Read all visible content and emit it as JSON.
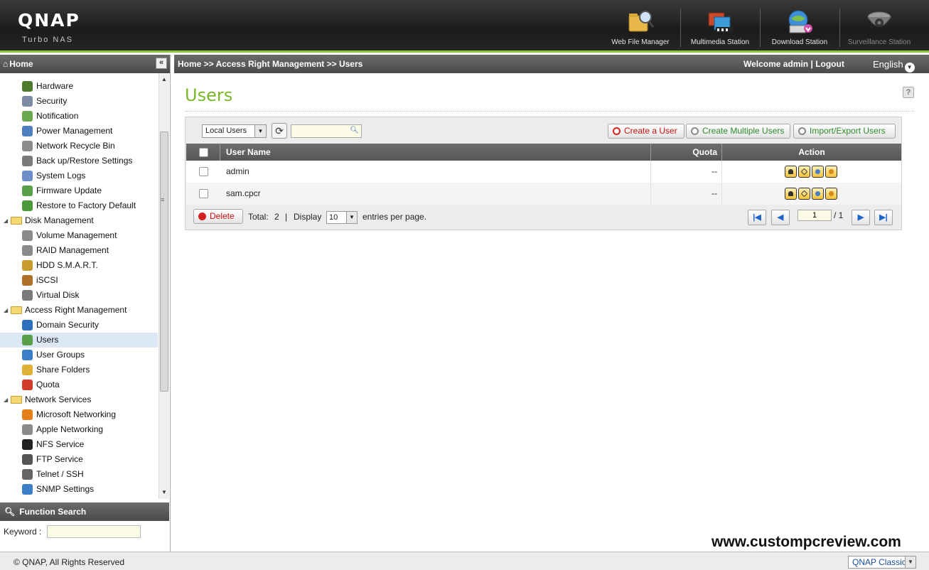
{
  "brand": {
    "logo": "QNAP",
    "subtitle": "Turbo NAS"
  },
  "apps": [
    {
      "label": "Web File Manager",
      "icon": "folder-magnifier-icon"
    },
    {
      "label": "Multimedia Station",
      "icon": "multimedia-icon"
    },
    {
      "label": "Download Station",
      "icon": "download-globe-icon"
    },
    {
      "label": "Surveillance Station",
      "icon": "camera-icon"
    }
  ],
  "sidebar": {
    "home_label": "Home",
    "collapse_glyph": "«",
    "items": [
      {
        "label": "Hardware",
        "icon": "hardware-icon",
        "color": "#4e7a2c"
      },
      {
        "label": "Security",
        "icon": "security-icon",
        "color": "#7d8aa3"
      },
      {
        "label": "Notification",
        "icon": "notification-icon",
        "color": "#6aa84f"
      },
      {
        "label": "Power Management",
        "icon": "power-icon",
        "color": "#4f7fc1"
      },
      {
        "label": "Network Recycle Bin",
        "icon": "recycle-bin-icon",
        "color": "#8c8c8c"
      },
      {
        "label": "Back up/Restore Settings",
        "icon": "backup-icon",
        "color": "#7a7a7a"
      },
      {
        "label": "System Logs",
        "icon": "logs-icon",
        "color": "#6d8fc9"
      },
      {
        "label": "Firmware Update",
        "icon": "firmware-icon",
        "color": "#5aa04b"
      },
      {
        "label": "Restore to Factory Default",
        "icon": "factory-default-icon",
        "color": "#4a9a3b"
      },
      {
        "label": "Disk Management",
        "icon": "folder-icon",
        "group": true
      },
      {
        "label": "Volume Management",
        "icon": "volume-icon",
        "color": "#8a8a8a"
      },
      {
        "label": "RAID Management",
        "icon": "raid-icon",
        "color": "#8a8a8a"
      },
      {
        "label": "HDD S.M.A.R.T.",
        "icon": "hdd-smart-icon",
        "color": "#c89b2f"
      },
      {
        "label": "iSCSI",
        "icon": "iscsi-icon",
        "color": "#b0702a"
      },
      {
        "label": "Virtual Disk",
        "icon": "virtual-disk-icon",
        "color": "#7a7a7a"
      },
      {
        "label": "Access Right Management",
        "icon": "folder-icon",
        "group": true
      },
      {
        "label": "Domain Security",
        "icon": "domain-security-icon",
        "color": "#2f6fbf"
      },
      {
        "label": "Users",
        "icon": "user-icon",
        "color": "#5aa04b",
        "selected": true
      },
      {
        "label": "User Groups",
        "icon": "user-groups-icon",
        "color": "#3b7fc8"
      },
      {
        "label": "Share Folders",
        "icon": "share-folders-icon",
        "color": "#e0b236"
      },
      {
        "label": "Quota",
        "icon": "quota-icon",
        "color": "#d23a2a"
      },
      {
        "label": "Network Services",
        "icon": "folder-icon",
        "group": true
      },
      {
        "label": "Microsoft Networking",
        "icon": "windows-icon",
        "color": "#e57f1a"
      },
      {
        "label": "Apple Networking",
        "icon": "apple-icon",
        "color": "#8a8a8a"
      },
      {
        "label": "NFS Service",
        "icon": "linux-icon",
        "color": "#222222"
      },
      {
        "label": "FTP Service",
        "icon": "ftp-icon",
        "color": "#555555"
      },
      {
        "label": "Telnet / SSH",
        "icon": "terminal-icon",
        "color": "#666666"
      },
      {
        "label": "SNMP Settings",
        "icon": "snmp-icon",
        "color": "#3b7fc8"
      }
    ]
  },
  "function_search": {
    "title": "Function Search",
    "keyword_label": "Keyword :",
    "value": ""
  },
  "header": {
    "breadcrumb": "Home >> Access Right Management >> Users",
    "welcome": "Welcome admin",
    "separator": "|",
    "logout": "Logout",
    "language": "English"
  },
  "page": {
    "title": "Users",
    "help": "?"
  },
  "toolbar": {
    "user_type": "Local Users",
    "search_value": "",
    "create_user": "Create a User",
    "create_multiple": "Create Multiple Users",
    "import_export": "Import/Export Users"
  },
  "table": {
    "columns": {
      "name": "User Name",
      "quota": "Quota",
      "action": "Action"
    },
    "rows": [
      {
        "name": "admin",
        "quota": "--"
      },
      {
        "name": "sam.cpcr",
        "quota": "--"
      }
    ]
  },
  "footer": {
    "delete": "Delete",
    "total_label": "Total:",
    "total": "2",
    "bar": "|",
    "display_label": "Display",
    "per_page": "10",
    "entries_label": "entries per page.",
    "page_current": "1",
    "page_total": "/ 1"
  },
  "watermark": "www.custompcreview.com",
  "statusbar": {
    "copyright": "© QNAP, All Rights Reserved",
    "theme": "QNAP Classic"
  },
  "colors": {
    "accent_green": "#7ab629",
    "topbar": "#1b1b1b",
    "selected_row": "#dde8f7"
  }
}
